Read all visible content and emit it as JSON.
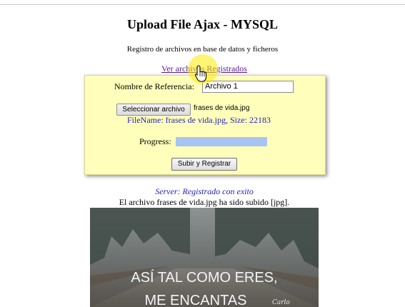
{
  "page": {
    "title": "Upload File Ajax - MYSQL",
    "subtitle": "Registro de archivos en base de datos y ficheros",
    "view_link": "Ver archivos Registrados"
  },
  "form": {
    "reference_label": "Nombre de Referencia:",
    "reference_value": "Archivo 1",
    "file_button": "Seleccionar archivo",
    "file_chosen": "frases de vida.jpg",
    "file_info": "FileName: frases de vida.jpg, Size: 22183",
    "progress_label": "Progress:",
    "progress_percent": 100,
    "submit_label": "Subir y Registrar"
  },
  "result": {
    "server_message": "Server: Registrado con exito",
    "upload_message": "El archivo frases de vida.jpg ha sido subido [jpg]."
  },
  "image": {
    "line1": "ASÍ TAL COMO ERES,",
    "line2": "ME ENCANTAS",
    "signature": "Carlo"
  },
  "colors": {
    "panel_bg": "#ffffbb",
    "link": "#551a8b",
    "info_text": "#2222bb",
    "progress_fill": "#a7c4f2"
  },
  "icons": [
    "hand-pointer-icon"
  ]
}
